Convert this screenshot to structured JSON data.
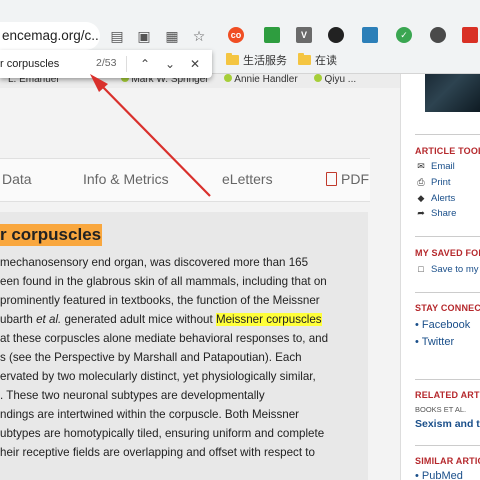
{
  "browser": {
    "url_fragment": "encemag.org/c...",
    "extensions": [
      {
        "name": "co-extension",
        "glyph": "co",
        "color": "#f04e23"
      },
      {
        "name": "green-extension",
        "glyph": "",
        "color": "#2e9d3f"
      },
      {
        "name": "v-extension",
        "glyph": "V",
        "color": "#6a6a6a"
      },
      {
        "name": "dark-extension",
        "glyph": "",
        "color": "#222222"
      },
      {
        "name": "blue-extension",
        "glyph": "",
        "color": "#2c7fb8"
      },
      {
        "name": "green-check-extension",
        "glyph": "✓",
        "color": "#3aa651"
      },
      {
        "name": "globe-extension",
        "glyph": "",
        "color": "#4a4a4a"
      },
      {
        "name": "red-extension",
        "glyph": "",
        "color": "#d93025"
      }
    ],
    "bookmarks": [
      {
        "label": "生活服务"
      },
      {
        "label": "在读"
      }
    ]
  },
  "find_bar": {
    "query": "r corpuscles",
    "count": "2/53"
  },
  "authors_line": {
    "a1": "L. Emanuel",
    "a2": "Mark W. Springel",
    "a3": "Annie Handler",
    "a4": "Qiyu ..."
  },
  "tabs": [
    {
      "label": "Data"
    },
    {
      "label": "Info & Metrics"
    },
    {
      "label": "eLetters"
    },
    {
      "label": "PDF"
    }
  ],
  "article": {
    "section_heading": "r corpuscles",
    "lines": [
      {
        "pre": "mechanosensory end organ, was discovered more than 165",
        "hl": "",
        "post": ""
      },
      {
        "pre": "een found in the glabrous skin of all mammals, including that on",
        "hl": "",
        "post": ""
      },
      {
        "pre": "prominently featured in textbooks, the function of the Meissner",
        "hl": "",
        "post": ""
      },
      {
        "pre": "ubarth et al. generated adult mice without ",
        "hl": "Meissner corpuscles",
        "post": ""
      },
      {
        "pre": "at these corpuscles alone mediate behavioral responses to, and",
        "hl": "",
        "post": ""
      },
      {
        "pre": "s (see the Perspective by Marshall and Patapoutian). Each",
        "hl": "",
        "post": ""
      },
      {
        "pre": "ervated by two molecularly distinct, yet physiologically similar,",
        "hl": "",
        "post": ""
      },
      {
        "pre": ". These two neuronal subtypes are developmentally",
        "hl": "",
        "post": ""
      },
      {
        "pre": "ndings are intertwined within the corpuscle. Both Meissner",
        "hl": "",
        "post": ""
      },
      {
        "pre": "ubtypes are homotypically tiled, ensuring uniform and complete",
        "hl": "",
        "post": ""
      },
      {
        "pre": "heir receptive fields are overlapping and offset with respect to",
        "hl": "",
        "post": ""
      }
    ]
  },
  "sidebar": {
    "article_tools_heading": "ARTICLE TOOL",
    "tools": [
      {
        "label": "Email",
        "icon": "envelope-icon"
      },
      {
        "label": "Print",
        "icon": "printer-icon"
      },
      {
        "label": "Alerts",
        "icon": "bell-icon"
      },
      {
        "label": "Share",
        "icon": "share-icon"
      }
    ],
    "saved_heading": "MY SAVED FOL",
    "save_label": "Save to my",
    "connect_heading": "STAY CONNECT",
    "connect_items": [
      {
        "label": "Facebook"
      },
      {
        "label": "Twitter"
      }
    ],
    "related_heading": "RELATED ARTIC",
    "related_sub": "BOOKS ET AL.",
    "related_title": "Sexism and th",
    "similar_heading": "SIMILAR ARTIC",
    "similar_item": "PubMed"
  },
  "colors": {
    "accent_red": "#b5282c",
    "link_blue": "#1a4f8a",
    "search_orange": "#f9a73e",
    "search_yellow": "#ffff3a"
  }
}
